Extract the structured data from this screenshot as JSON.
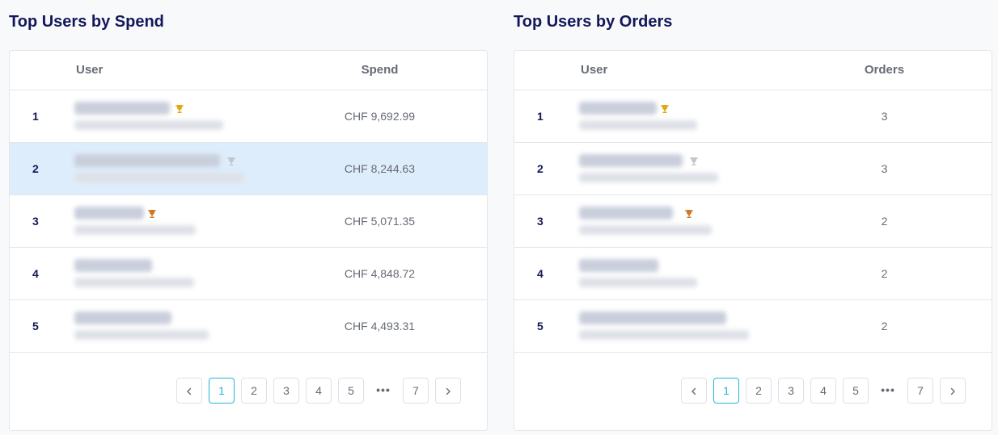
{
  "spend_panel": {
    "title": "Top Users by Spend",
    "columns": {
      "user": "User",
      "value": "Spend"
    },
    "rows": [
      {
        "rank": "1",
        "value": "CHF 9,692.99",
        "trophy": "gold-trophy-icon",
        "trophy_color": "#e3a70f"
      },
      {
        "rank": "2",
        "value": "CHF 8,244.63",
        "trophy": "silver-trophy-icon",
        "trophy_color": "#c3c6cc",
        "selected": true
      },
      {
        "rank": "3",
        "value": "CHF 5,071.35",
        "trophy": "bronze-trophy-icon",
        "trophy_color": "#cd7a26"
      },
      {
        "rank": "4",
        "value": "CHF 4,848.72"
      },
      {
        "rank": "5",
        "value": "CHF 4,493.31"
      }
    ],
    "pagination": {
      "prev": "‹",
      "pages": [
        "1",
        "2",
        "3",
        "4",
        "5"
      ],
      "ellipsis": "•••",
      "last": "7",
      "next": "›",
      "active": "1"
    }
  },
  "orders_panel": {
    "title": "Top Users by Orders",
    "columns": {
      "user": "User",
      "value": "Orders"
    },
    "rows": [
      {
        "rank": "1",
        "value": "3",
        "trophy": "gold-trophy-icon",
        "trophy_color": "#e3a70f"
      },
      {
        "rank": "2",
        "value": "3",
        "trophy": "silver-trophy-icon",
        "trophy_color": "#c3c6cc"
      },
      {
        "rank": "3",
        "value": "2",
        "trophy": "bronze-trophy-icon",
        "trophy_color": "#cd7a26"
      },
      {
        "rank": "4",
        "value": "2"
      },
      {
        "rank": "5",
        "value": "2"
      }
    ],
    "pagination": {
      "prev": "‹",
      "pages": [
        "1",
        "2",
        "3",
        "4",
        "5"
      ],
      "ellipsis": "•••",
      "last": "7",
      "next": "›",
      "active": "1"
    }
  },
  "colors": {
    "title": "#14175a",
    "selected_row": "#deedfb",
    "active_page": "#22b8d4"
  }
}
